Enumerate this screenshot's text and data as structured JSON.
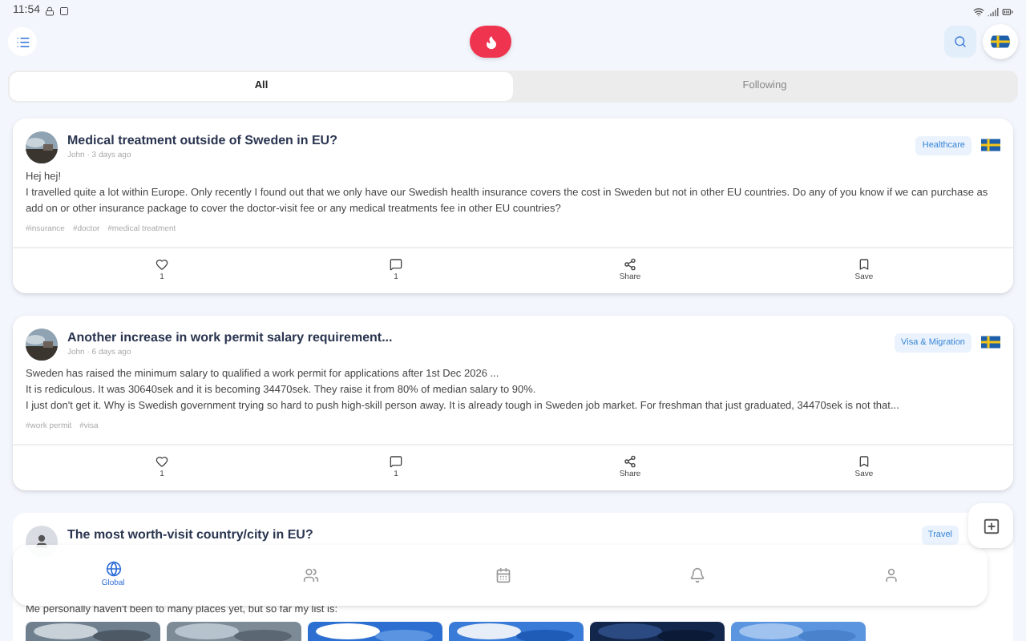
{
  "status_bar": {
    "time": "11:54"
  },
  "tabs": [
    {
      "label": "All",
      "selected": true
    },
    {
      "label": "Following",
      "selected": false
    }
  ],
  "posts": [
    {
      "title": "Medical treatment outside of Sweden in EU?",
      "meta": "John · 3 days ago",
      "category": "Healthcare",
      "body": [
        "Hej hej!",
        "I travelled quite a lot within Europe. Only recently I found out that we only have our Swedish health insurance covers the cost in Sweden but not in other EU countries. Do any of you know if we can purchase as add on or other insurance package to cover the doctor-visit fee or any medical treatments fee in other EU countries?"
      ],
      "tags": [
        "#insurance",
        "#doctor",
        "#medical treatment"
      ],
      "liked": false,
      "likes": "1",
      "comments": "1",
      "share": "Share",
      "save": "Save"
    },
    {
      "title": "Another increase in work permit salary requirement...",
      "meta": "John · 6 days ago",
      "category": "Visa & Migration",
      "body": [
        "Sweden has raised the minimum salary to qualified a work permit for applications after 1st Dec 2026 ...",
        "It is rediculous. It was 30640sek and it is becoming 34470sek. They raise it from 80% of median salary to 90%.",
        "I just don't get it. Why is Swedish government trying so hard to push high-skill person away. It is already tough in Sweden job market. For freshman that just graduated, 34470sek is not that..."
      ],
      "tags": [
        "#work permit",
        "#visa"
      ],
      "liked": false,
      "likes": "1",
      "comments": "1",
      "share": "Share",
      "save": "Save"
    }
  ],
  "partial_post": {
    "title": "The most worth-visit country/city in EU?",
    "category": "Travel",
    "body": "Me personally haven't been to many places yet, but so far my list is:"
  },
  "bottom_nav": [
    {
      "label": "Global",
      "selected": true
    },
    {
      "selected": false
    },
    {
      "selected": false
    },
    {
      "selected": false
    },
    {
      "selected": false
    }
  ]
}
